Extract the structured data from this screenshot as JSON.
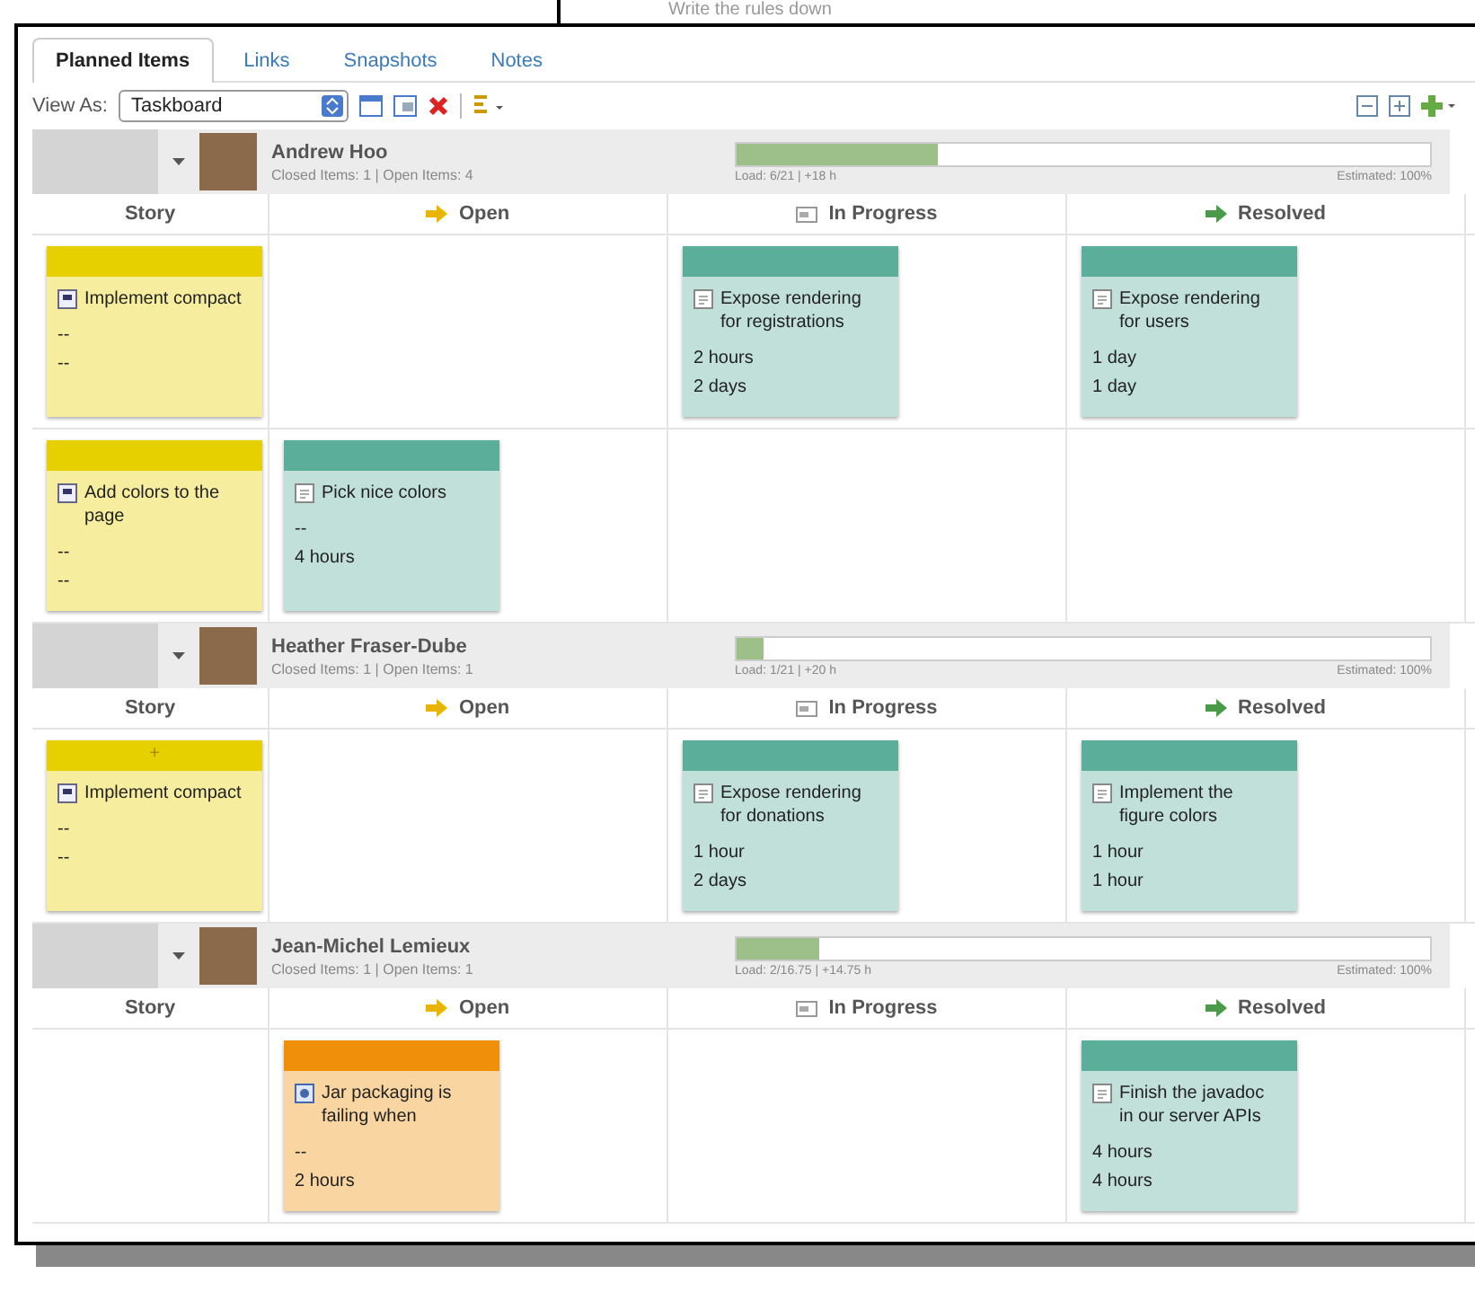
{
  "background_window": {
    "text": "Write the rules down"
  },
  "tabs": [
    {
      "label": "Planned Items",
      "selected": true
    },
    {
      "label": "Links",
      "selected": false
    },
    {
      "label": "Snapshots",
      "selected": false
    },
    {
      "label": "Notes",
      "selected": false
    }
  ],
  "toolbar": {
    "view_as_label": "View As:",
    "view_as_value": "Taskboard"
  },
  "groups": [
    {
      "name": "Andrew Hoo",
      "summary": "Closed Items: 1 | Open Items: 4",
      "load": "Load: 6/21 | +18 h",
      "estimated": "Estimated: 100%",
      "level": 0.29,
      "columns": [
        {
          "label": "Story",
          "kind": "story"
        },
        {
          "label": "Open",
          "kind": "open"
        },
        {
          "label": "In Progress",
          "kind": "progress"
        },
        {
          "label": "Resolved",
          "kind": "resolved"
        }
      ],
      "rows": [
        [
          {
            "kind": "story",
            "color": "#e6d000",
            "title": "Implement compact",
            "lines": [
              "--",
              "--"
            ]
          },
          null,
          {
            "kind": "task",
            "color": "#5aae9a",
            "title": "Expose rendering for registrations",
            "lines": [
              "2 hours",
              "2 days"
            ]
          },
          {
            "kind": "task",
            "color": "#5aae9a",
            "title": "Expose rendering for users",
            "lines": [
              "1 day",
              "1 day"
            ]
          }
        ],
        [
          {
            "kind": "story",
            "color": "#e6d000",
            "title": "Add colors to the page",
            "lines": [
              "--",
              "--"
            ]
          },
          {
            "kind": "task",
            "color": "#5aae9a",
            "title": "Pick nice colors",
            "lines": [
              "--",
              "4 hours"
            ]
          },
          null,
          null
        ]
      ]
    },
    {
      "name": "Heather Fraser-Dube",
      "summary": "Closed Items: 1 | Open Items: 1",
      "load": "Load: 1/21 | +20 h",
      "estimated": "Estimated: 100%",
      "level": 0.04,
      "columns": [
        {
          "label": "Story",
          "kind": "story"
        },
        {
          "label": "Open",
          "kind": "open"
        },
        {
          "label": "In Progress",
          "kind": "progress"
        },
        {
          "label": "Resolved",
          "kind": "resolved"
        }
      ],
      "rows": [
        [
          {
            "kind": "story",
            "color": "#e6d000",
            "header_text": "+",
            "title": "Implement compact",
            "lines": [
              "--",
              "--"
            ]
          },
          null,
          {
            "kind": "task",
            "color": "#5aae9a",
            "title": "Expose rendering for donations",
            "lines": [
              "1 hour",
              "2 days"
            ]
          },
          {
            "kind": "task",
            "color": "#5aae9a",
            "title": "Implement the figure colors",
            "lines": [
              "1 hour",
              "1 hour"
            ]
          }
        ]
      ]
    },
    {
      "name": "Jean-Michel Lemieux",
      "summary": "Closed Items: 1 | Open Items: 1",
      "load": "Load: 2/16.75 | +14.75 h",
      "estimated": "Estimated: 100%",
      "level": 0.12,
      "columns": [
        {
          "label": "Story",
          "kind": "story"
        },
        {
          "label": "Open",
          "kind": "open"
        },
        {
          "label": "In Progress",
          "kind": "progress"
        },
        {
          "label": "Resolved",
          "kind": "resolved"
        }
      ],
      "rows": [
        [
          null,
          {
            "kind": "defect",
            "color": "#f0900a",
            "title": "Jar packaging is failing when",
            "lines": [
              "--",
              "2 hours"
            ]
          },
          null,
          {
            "kind": "task",
            "color": "#5aae9a",
            "title": "Finish the javadoc in our server APIs",
            "lines": [
              "4 hours",
              "4 hours"
            ]
          }
        ]
      ]
    }
  ]
}
